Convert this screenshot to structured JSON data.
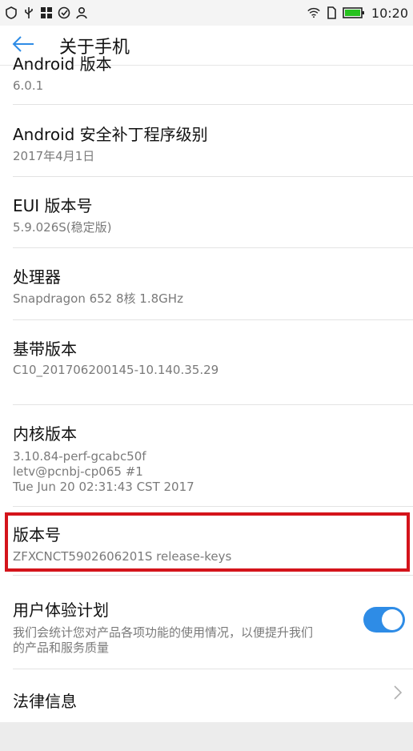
{
  "status_bar": {
    "time": "10:20",
    "icons": [
      "shield-icon",
      "usb-icon",
      "apps-icon",
      "check-icon",
      "person-icon",
      "wifi-icon",
      "sim-icon",
      "battery-icon"
    ]
  },
  "header": {
    "title": "关于手机"
  },
  "items": [
    {
      "title": "Android 版本",
      "subtitle": "6.0.1"
    },
    {
      "title": "Android 安全补丁程序级别",
      "subtitle": "2017年4月1日"
    },
    {
      "title": "EUI 版本号",
      "subtitle": "5.9.026S(稳定版)"
    },
    {
      "title": "处理器",
      "subtitle": "Snapdragon 652 8核 1.8GHz"
    },
    {
      "title": "基带版本",
      "subtitle": "C10_201706200145-10.140.35.29"
    },
    {
      "title": "内核版本",
      "subtitle_lines": [
        "3.10.84-perf-gcabc50f",
        "letv@pcnbj-cp065 #1",
        "Tue Jun 20 02:31:43 CST 2017"
      ]
    },
    {
      "title": "版本号",
      "subtitle": "ZFXCNCT5902606201S release-keys"
    },
    {
      "title": "用户体验计划",
      "subtitle_lines": [
        "我们会统计您对产品各项功能的使用情况，以便提升我们",
        "的产品和服务质量"
      ],
      "toggle_on": true
    },
    {
      "title": "法律信息"
    }
  ],
  "colors": {
    "accent": "#2e8ce6",
    "highlight": "#d4141b"
  }
}
